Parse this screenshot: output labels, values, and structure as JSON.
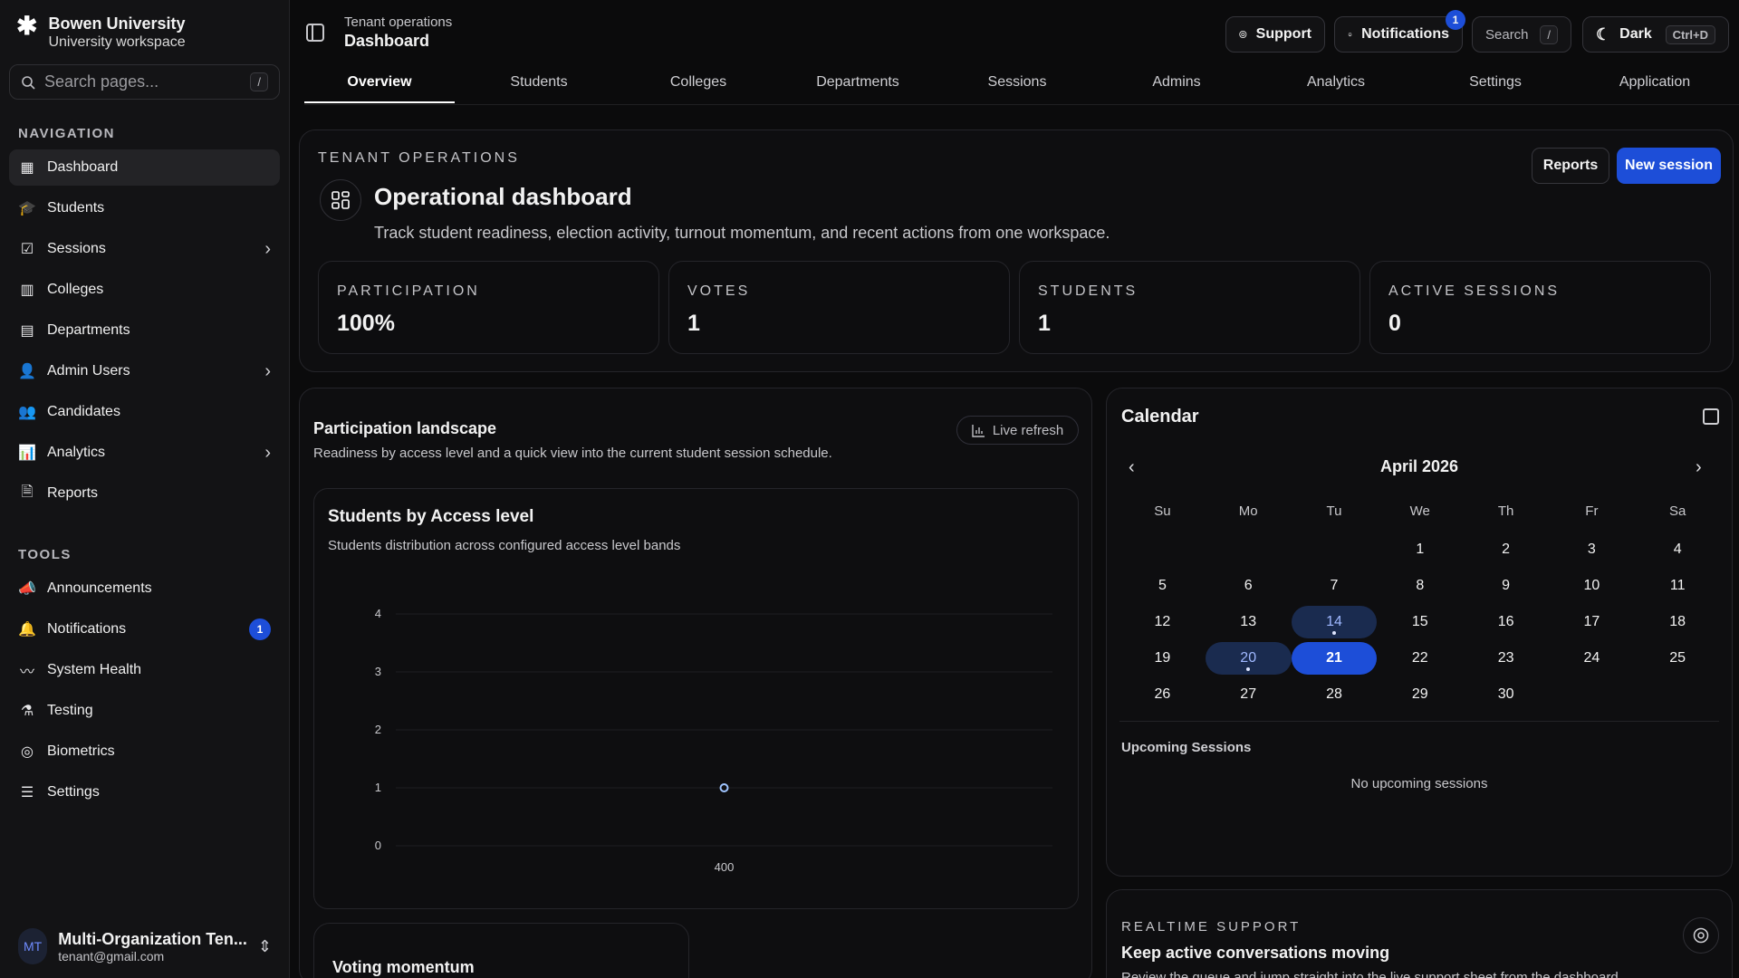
{
  "brand": {
    "name": "Bowen University",
    "subtitle": "University workspace"
  },
  "sidebar_search": {
    "placeholder": "Search pages...",
    "shortcut": "/"
  },
  "nav_section": "NAVIGATION",
  "nav_items": [
    {
      "label": "Dashboard",
      "icon": "dashboard-icon",
      "active": true
    },
    {
      "label": "Students",
      "icon": "graduation-cap-icon"
    },
    {
      "label": "Sessions",
      "icon": "ballot-icon",
      "chevron": true
    },
    {
      "label": "Colleges",
      "icon": "building-icon"
    },
    {
      "label": "Departments",
      "icon": "department-icon"
    },
    {
      "label": "Admin Users",
      "icon": "admin-user-icon",
      "chevron": true
    },
    {
      "label": "Candidates",
      "icon": "users-icon"
    },
    {
      "label": "Analytics",
      "icon": "bar-chart-icon",
      "chevron": true
    },
    {
      "label": "Reports",
      "icon": "file-icon"
    }
  ],
  "tools_section": "TOOLS",
  "tool_items": [
    {
      "label": "Announcements",
      "icon": "megaphone-icon"
    },
    {
      "label": "Notifications",
      "icon": "bell-icon",
      "badge": "1"
    },
    {
      "label": "System Health",
      "icon": "activity-icon"
    },
    {
      "label": "Testing",
      "icon": "flask-icon"
    },
    {
      "label": "Biometrics",
      "icon": "fingerprint-icon"
    },
    {
      "label": "Settings",
      "icon": "sliders-icon"
    }
  ],
  "user": {
    "initials": "MT",
    "name": "Multi-Organization Ten...",
    "email": "tenant@gmail.com"
  },
  "header": {
    "breadcrumb_parent": "Tenant operations",
    "breadcrumb_current": "Dashboard",
    "support": "Support",
    "notifications": "Notifications",
    "notifications_count": "1",
    "search": "Search",
    "search_shortcut": "/",
    "theme": "Dark",
    "theme_shortcut": "Ctrl+D"
  },
  "tabs": [
    "Overview",
    "Students",
    "Colleges",
    "Departments",
    "Sessions",
    "Admins",
    "Analytics",
    "Settings",
    "Application"
  ],
  "hero": {
    "eyebrow": "TENANT OPERATIONS",
    "title": "Operational dashboard",
    "description": "Track student readiness, election activity, turnout momentum, and recent actions from one workspace.",
    "reports_button": "Reports",
    "new_session_button": "New session"
  },
  "stats": [
    {
      "label": "PARTICIPATION",
      "value": "100%"
    },
    {
      "label": "VOTES",
      "value": "1"
    },
    {
      "label": "STUDENTS",
      "value": "1"
    },
    {
      "label": "ACTIVE SESSIONS",
      "value": "0"
    }
  ],
  "landscape": {
    "title": "Participation landscape",
    "subtitle": "Readiness by access level and a quick view into the current student session schedule.",
    "live_refresh": "Live refresh"
  },
  "chart_card": {
    "title": "Students by Access level",
    "subtitle": "Students distribution across configured access level bands"
  },
  "chart_data": {
    "type": "scatter",
    "categories": [
      "400"
    ],
    "values": [
      1
    ],
    "yticks": [
      0,
      1,
      2,
      3,
      4
    ],
    "ylim": [
      0,
      4
    ],
    "grid": true,
    "color": "#9fc4ff"
  },
  "momentum": {
    "title": "Voting momentum"
  },
  "calendar": {
    "title": "Calendar",
    "month": "April 2026",
    "weekdays": [
      "Su",
      "Mo",
      "Tu",
      "We",
      "Th",
      "Fr",
      "Sa"
    ],
    "weeks": [
      [
        "",
        "",
        "",
        "1",
        "2",
        "3",
        "4"
      ],
      [
        "5",
        "6",
        "7",
        "8",
        "9",
        "10",
        "11"
      ],
      [
        "12",
        "13",
        "14",
        "15",
        "16",
        "17",
        "18"
      ],
      [
        "19",
        "20",
        "21",
        "22",
        "23",
        "24",
        "25"
      ],
      [
        "26",
        "27",
        "28",
        "29",
        "30",
        "",
        ""
      ]
    ],
    "highlighted": [
      "14",
      "20"
    ],
    "selected": "21",
    "dotted": [
      "14",
      "20"
    ],
    "upcoming_label": "Upcoming Sessions",
    "empty_text": "No upcoming sessions"
  },
  "support_card": {
    "eyebrow": "REALTIME SUPPORT",
    "title": "Keep active conversations moving",
    "description": "Review the queue and jump straight into the live support sheet from the dashboard."
  }
}
